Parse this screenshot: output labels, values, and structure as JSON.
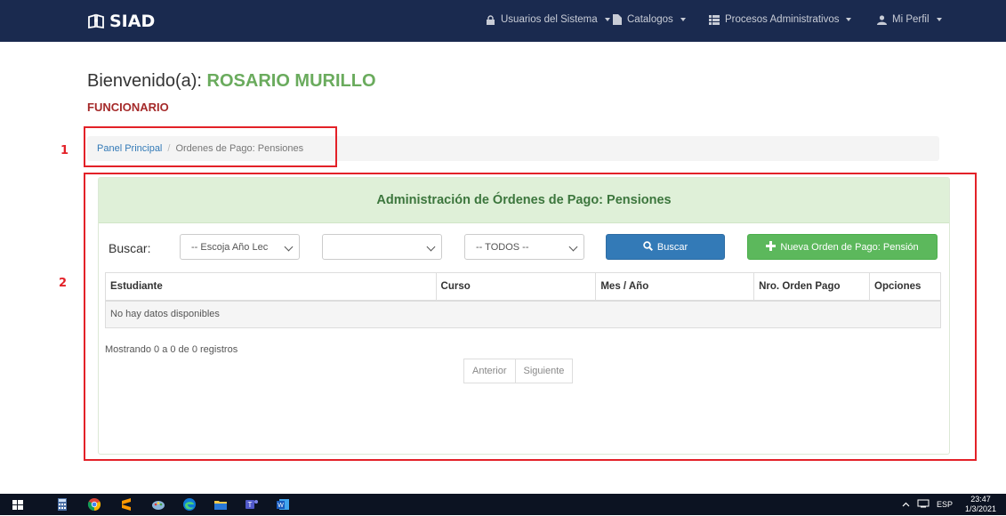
{
  "navbar": {
    "brand": "SIAD",
    "items": [
      {
        "label": "Usuarios del Sistema",
        "icon": "lock-icon"
      },
      {
        "label": "Catalogos",
        "icon": "file-icon"
      },
      {
        "label": "Procesos Administrativos",
        "icon": "list-icon"
      },
      {
        "label": "Mi Perfil",
        "icon": "user-icon"
      }
    ]
  },
  "welcome": {
    "prefix": "Bienvenido(a):",
    "name": "ROSARIO MURILLO",
    "role": "FUNCIONARIO"
  },
  "breadcrumb": {
    "home": "Panel Principal",
    "separator": "/",
    "current": "Ordenes de Pago: Pensiones"
  },
  "annotations": {
    "box1": "1",
    "box2": "2"
  },
  "panel": {
    "title": "Administración de Órdenes de Pago: Pensiones",
    "search_label": "Buscar:",
    "select_year": "-- Escoja Año Lec",
    "select_course": "",
    "select_status": "-- TODOS --",
    "search_button": "Buscar",
    "new_button": "Nueva Orden de Pago: Pensión"
  },
  "table": {
    "headers": [
      "Estudiante",
      "Curso",
      "Mes / Año",
      "Nro. Orden Pago",
      "Opciones"
    ],
    "empty": "No hay datos disponibles",
    "info": "Mostrando 0 a 0 de 0 registros",
    "prev": "Anterior",
    "next": "Siguiente"
  },
  "taskbar": {
    "lang": "ESP",
    "time": "23:47",
    "date": "1/3/2021"
  },
  "colors": {
    "navbar": "#1a2a4f",
    "accent_green": "#6aab5d",
    "role_red": "#a52a2a",
    "annotation_red": "#e32128",
    "panel_head": "#dff0d8"
  }
}
